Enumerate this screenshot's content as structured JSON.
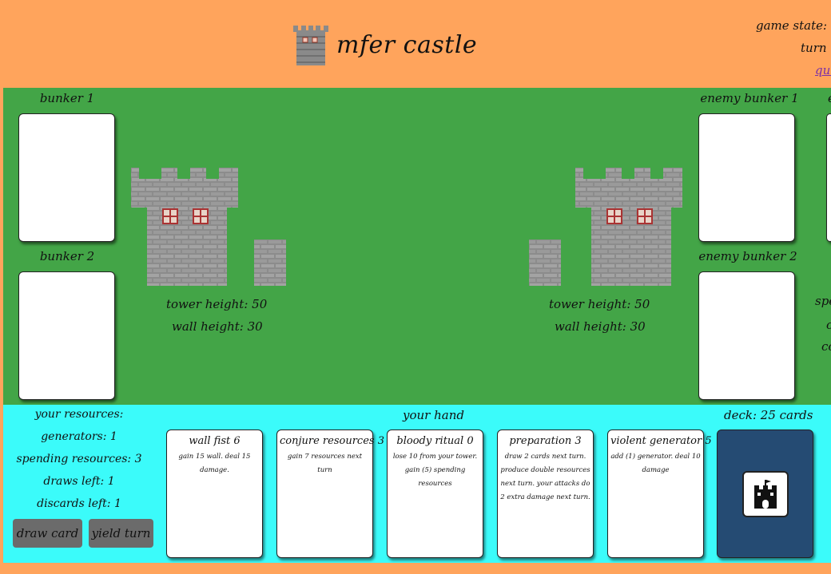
{
  "header": {
    "title": "mfer castle",
    "status_line1": "game state: o",
    "status_line2": "turn :",
    "status_link": "qui"
  },
  "board": {
    "player_bunker_1_label": "bunker 1",
    "player_bunker_2_label": "bunker 2",
    "enemy_bunker_1_label": "enemy bunker 1",
    "enemy_bunker_2_label": "enemy bunker 2",
    "player_tower_height": "tower height: 50",
    "player_wall_height": "wall height: 30",
    "enemy_tower_height": "tower height: 50",
    "enemy_wall_height": "wall height: 30",
    "cut_right_label_top": "e",
    "cut_right_label_spe": "spe",
    "cut_right_label_c1": "c",
    "cut_right_label_c2": "co"
  },
  "resources": {
    "heading": "your resources:",
    "generators": "generators: 1",
    "spending": "spending resources: 3",
    "draws": "draws left: 1",
    "discards": "discards left: 1"
  },
  "buttons": {
    "draw_card": "draw card",
    "yield_turn": "yield turn"
  },
  "hand": {
    "heading": "your hand",
    "cards": [
      {
        "title": "wall fist 6",
        "desc": "gain 15 wall. deal 15 damage."
      },
      {
        "title": "conjure resources 3",
        "desc": "gain 7 resources next turn"
      },
      {
        "title": "bloody ritual 0",
        "desc": "lose 10 from your tower. gain (5) spending resources"
      },
      {
        "title": "preparation 3",
        "desc": "draw 2 cards next turn. produce double resources next turn. your attacks do 2 extra damage next turn."
      },
      {
        "title": "violent generator 5",
        "desc": "add (1) generator. deal 10 damage"
      }
    ]
  },
  "deck": {
    "label": "deck: 25 cards",
    "icon": "castle-icon"
  },
  "colors": {
    "header_bg": "#FFA45C",
    "board_bg": "#43A547",
    "hand_bg": "#3BFBFA",
    "deck_bg": "#254B73",
    "button_bg": "#6b6b6b"
  }
}
